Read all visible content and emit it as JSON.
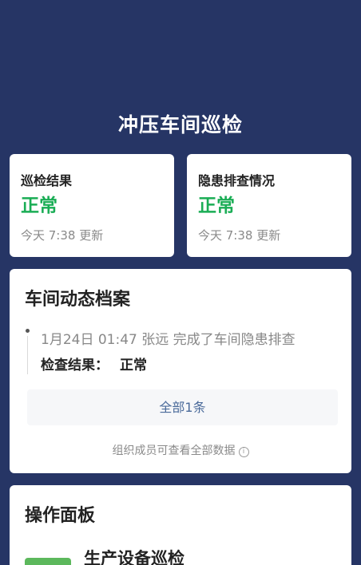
{
  "page": {
    "title": "冲压车间巡检"
  },
  "status_cards": [
    {
      "label": "巡检结果",
      "value": "正常",
      "updated": "今天 7:38 更新"
    },
    {
      "label": "隐患排查情况",
      "value": "正常",
      "updated": "今天 7:38 更新"
    }
  ],
  "archive": {
    "title": "车间动态档案",
    "entries": [
      {
        "text": "1月24日 01:47  张远  完成了车间隐患排查",
        "result_label": "检查结果：",
        "result_value": "正常"
      }
    ],
    "all_button_label": "全部1条",
    "footnote": "组织成员可查看全部数据"
  },
  "panel": {
    "title": "操作面板",
    "items": [
      {
        "label": "生产设备巡检"
      }
    ]
  },
  "colors": {
    "background": "#263565",
    "status_ok": "#1aad55",
    "link": "#4a6a9a",
    "panel_icon": "#5cb85c"
  },
  "icons": {
    "info": "info-circle-icon"
  }
}
